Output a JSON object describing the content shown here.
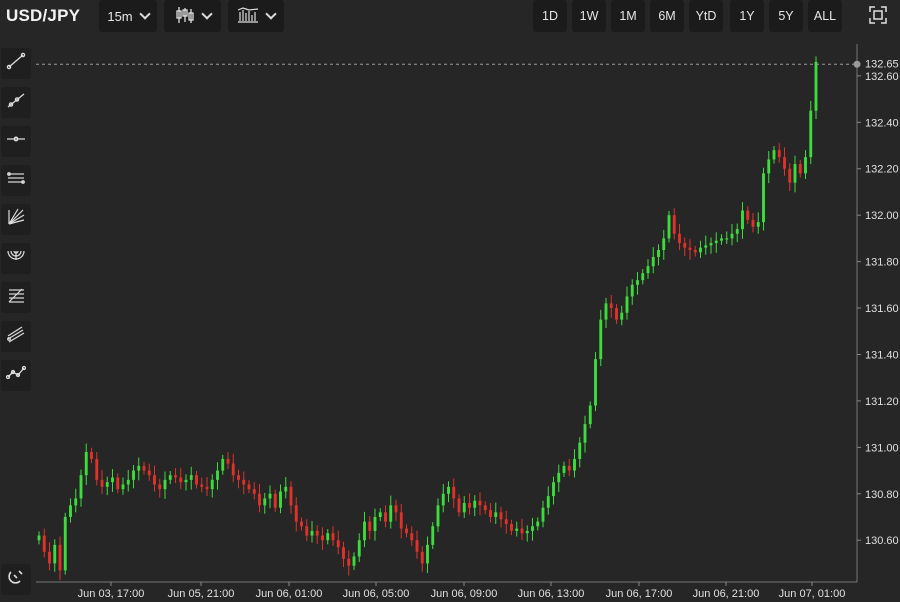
{
  "toolbar": {
    "symbol": "USD/JPY",
    "interval": "15m",
    "chart_style_icon": "candlestick-icon",
    "indicators_icon": "indicators-icon",
    "ranges": [
      "1D",
      "1W",
      "1M",
      "6M",
      "YtD",
      "1Y",
      "5Y",
      "ALL"
    ],
    "fullscreen_icon": "fullscreen-icon"
  },
  "tools": [
    {
      "name": "trend-line-icon"
    },
    {
      "name": "ray-line-icon"
    },
    {
      "name": "horizontal-line-icon"
    },
    {
      "name": "parallel-channel-icon"
    },
    {
      "name": "fib-fan-icon"
    },
    {
      "name": "fib-arcs-icon"
    },
    {
      "name": "fib-retracement-icon"
    },
    {
      "name": "pitchfork-icon"
    },
    {
      "name": "zigzag-icon"
    },
    {
      "name": "magnet-icon"
    }
  ],
  "colors": {
    "background": "#262626",
    "up": "#3ddc3d",
    "down": "#e0312a",
    "crosshair": "#9a9a9a"
  },
  "chart_data": {
    "type": "candlestick",
    "last_price": "132.65",
    "y_ticks": [
      "132.60",
      "132.40",
      "132.20",
      "132.00",
      "131.80",
      "131.60",
      "131.40",
      "131.20",
      "131.00",
      "130.80",
      "130.60"
    ],
    "x_ticks": [
      "Jun 03, 17:00",
      "Jun 05, 21:00",
      "Jun 06, 01:00",
      "Jun 06, 05:00",
      "Jun 06, 09:00",
      "Jun 06, 13:00",
      "Jun 06, 17:00",
      "Jun 06, 21:00",
      "Jun 07, 01:00"
    ],
    "ylim": [
      130.42,
      132.72
    ],
    "close": [
      130.62,
      130.55,
      130.5,
      130.58,
      130.47,
      130.7,
      130.75,
      130.78,
      130.88,
      130.98,
      130.95,
      130.86,
      130.83,
      130.85,
      130.87,
      130.82,
      130.84,
      130.86,
      130.9,
      130.92,
      130.9,
      130.88,
      130.84,
      130.82,
      130.86,
      130.88,
      130.87,
      130.85,
      130.86,
      130.88,
      130.84,
      130.83,
      130.82,
      130.86,
      130.9,
      130.95,
      130.93,
      130.88,
      130.86,
      130.84,
      130.82,
      130.8,
      130.75,
      130.78,
      130.8,
      130.74,
      130.81,
      130.83,
      130.75,
      130.68,
      130.66,
      130.62,
      130.64,
      130.62,
      130.6,
      130.63,
      130.6,
      130.57,
      130.52,
      130.49,
      130.53,
      130.6,
      130.68,
      130.64,
      130.7,
      130.72,
      130.68,
      130.75,
      130.72,
      130.65,
      130.63,
      130.6,
      130.55,
      130.5,
      130.58,
      130.66,
      130.75,
      130.8,
      130.83,
      130.78,
      130.72,
      130.76,
      130.74,
      130.77,
      130.75,
      130.73,
      130.7,
      130.72,
      130.69,
      130.67,
      130.64,
      130.65,
      130.63,
      130.64,
      130.66,
      130.68,
      130.74,
      130.79,
      130.85,
      130.89,
      130.92,
      130.9,
      130.95,
      131.02,
      131.1,
      131.18,
      131.38,
      131.55,
      131.62,
      131.6,
      131.55,
      131.58,
      131.65,
      131.7,
      131.72,
      131.75,
      131.78,
      131.82,
      131.85,
      131.9,
      132.0,
      131.92,
      131.88,
      131.86,
      131.85,
      131.84,
      131.86,
      131.87,
      131.88,
      131.89,
      131.9,
      131.9,
      131.92,
      131.94,
      132.02,
      131.98,
      131.95,
      131.97,
      132.18,
      132.24,
      132.28,
      132.25,
      132.2,
      132.14,
      132.22,
      132.18,
      132.25,
      132.45,
      132.66
    ]
  }
}
